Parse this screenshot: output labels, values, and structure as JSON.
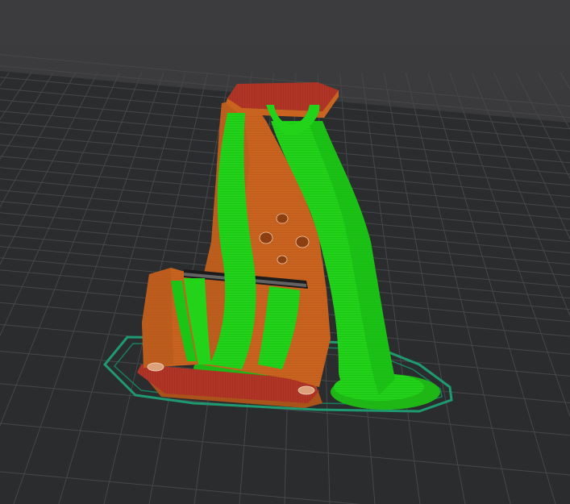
{
  "viewport": {
    "mode": "preview",
    "content": "sliced-model-preview"
  },
  "colors": {
    "background": "#3a3a3c",
    "bed": "#2b2c2e",
    "bed_grid": "#4a4b4e",
    "model": "#c8641f",
    "model_shade": "#a9521a",
    "model_top": "#b13526",
    "support": "#22d31a",
    "support_shade": "#13a812",
    "skirt": "#1f9a70",
    "wipe": "#4aa8a0"
  },
  "icons": {
    "bed": "print-bed-grid",
    "model": "sliced-part",
    "support": "tree-support",
    "skirt": "skirt-loop"
  }
}
